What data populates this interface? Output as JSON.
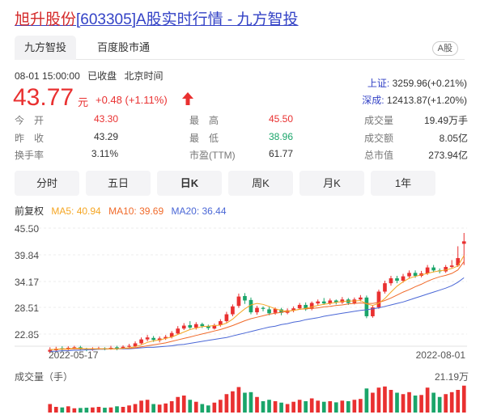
{
  "title": {
    "name": "旭升股份",
    "code": "[603305]",
    "suffix": "A股实时行情 - 九方智投"
  },
  "tabs": [
    {
      "label": "九方智投"
    },
    {
      "label": "百度股市通"
    }
  ],
  "badge": "A股",
  "status": {
    "time": "08-01 15:00:00",
    "state": "已收盘",
    "tz": "北京时间"
  },
  "quote": {
    "price": "43.77",
    "unit": "元",
    "change": "+0.48",
    "change_pct": "(+1.11%)"
  },
  "indices": [
    {
      "name": "上证:",
      "value": "3259.96(+0.21%)"
    },
    {
      "name": "深成:",
      "value": "12413.87(+1.20%)"
    }
  ],
  "stats": {
    "open_label": "今　开",
    "open": "43.30",
    "prev_label": "昨　收",
    "prev": "43.29",
    "turnover_label": "换手率",
    "turnover": "3.11%",
    "high_label": "最　高",
    "high": "45.50",
    "low_label": "最　低",
    "low": "38.96",
    "pe_label": "市盈(TTM)",
    "pe": "61.77",
    "vol_label": "成交量",
    "vol": "19.49万手",
    "amt_label": "成交额",
    "amt": "8.05亿",
    "cap_label": "总市值",
    "cap": "273.94亿"
  },
  "periods": [
    {
      "label": "分时"
    },
    {
      "label": "五日"
    },
    {
      "label": "日K"
    },
    {
      "label": "周K"
    },
    {
      "label": "月K"
    },
    {
      "label": "1年"
    }
  ],
  "active_period": "日K",
  "ma": {
    "adjust": "前复权",
    "ma5": "MA5: 40.94",
    "ma10": "MA10: 39.69",
    "ma20": "MA20: 36.44"
  },
  "colors": {
    "up": "#e93030",
    "down": "#1aa56a",
    "ma5": "#f5a623",
    "ma10": "#f06a2a",
    "ma20": "#4a67d6",
    "link": "#3342c6"
  },
  "chart_data": {
    "type": "candlestick",
    "y_ticks": [
      "45.50",
      "39.84",
      "34.17",
      "28.51",
      "22.85"
    ],
    "ylim": [
      22.85,
      45.5
    ],
    "x_start": "2022-05-17",
    "x_end": "2022-08-01",
    "volume_title": "成交量（手）",
    "volume_max": "21.19万",
    "candles": [
      [
        21.4,
        21.8,
        22.3,
        21.2
      ],
      [
        21.7,
        22.0,
        22.4,
        21.5
      ],
      [
        22.1,
        21.9,
        22.5,
        21.6
      ],
      [
        21.9,
        22.2,
        22.5,
        21.7
      ],
      [
        22.1,
        22.3,
        22.6,
        21.9
      ],
      [
        22.3,
        21.9,
        22.6,
        21.8
      ],
      [
        21.9,
        21.8,
        22.2,
        21.5
      ],
      [
        21.8,
        22.0,
        22.3,
        21.6
      ],
      [
        22.0,
        22.1,
        22.4,
        21.8
      ],
      [
        22.1,
        21.9,
        22.3,
        21.7
      ],
      [
        21.9,
        22.2,
        22.6,
        21.8
      ],
      [
        22.3,
        22.0,
        22.6,
        21.7
      ],
      [
        22.0,
        22.4,
        22.7,
        21.9
      ],
      [
        22.4,
        22.6,
        23.0,
        22.2
      ],
      [
        22.5,
        23.1,
        23.5,
        22.3
      ],
      [
        23.1,
        23.9,
        24.3,
        22.9
      ],
      [
        23.9,
        24.3,
        24.8,
        23.5
      ],
      [
        24.2,
        23.8,
        24.6,
        23.4
      ],
      [
        23.7,
        24.1,
        24.5,
        23.3
      ],
      [
        24.1,
        24.4,
        24.8,
        23.8
      ],
      [
        24.4,
        25.2,
        25.6,
        24.1
      ],
      [
        25.1,
        26.1,
        26.6,
        24.9
      ],
      [
        26.1,
        26.7,
        27.2,
        25.8
      ],
      [
        26.8,
        26.3,
        27.6,
        26.0
      ],
      [
        26.3,
        27.0,
        27.4,
        25.9
      ],
      [
        27.0,
        26.6,
        27.3,
        26.2
      ],
      [
        26.6,
        26.2,
        26.9,
        25.8
      ],
      [
        26.1,
        26.8,
        27.1,
        25.9
      ],
      [
        26.8,
        27.6,
        28.0,
        26.5
      ],
      [
        27.6,
        29.0,
        29.5,
        27.3
      ],
      [
        29.0,
        30.6,
        31.0,
        28.6
      ],
      [
        30.7,
        32.6,
        33.2,
        30.3
      ],
      [
        32.7,
        31.8,
        33.3,
        31.1
      ],
      [
        31.9,
        29.4,
        32.4,
        29.0
      ],
      [
        29.4,
        30.3,
        30.7,
        28.9
      ],
      [
        30.3,
        30.1,
        30.6,
        29.6
      ],
      [
        30.0,
        29.2,
        30.5,
        28.8
      ],
      [
        29.3,
        30.1,
        30.4,
        28.9
      ],
      [
        30.0,
        29.3,
        30.3,
        28.8
      ],
      [
        29.3,
        29.8,
        30.2,
        29.0
      ],
      [
        29.8,
        30.2,
        30.6,
        29.4
      ],
      [
        30.2,
        30.9,
        31.3,
        29.9
      ],
      [
        30.9,
        30.0,
        31.4,
        29.7
      ],
      [
        30.1,
        31.3,
        31.6,
        29.8
      ],
      [
        31.2,
        31.6,
        32.0,
        30.8
      ],
      [
        31.6,
        31.2,
        32.3,
        30.9
      ],
      [
        31.2,
        31.8,
        32.2,
        30.9
      ],
      [
        31.8,
        31.4,
        32.0,
        31.0
      ],
      [
        31.4,
        32.0,
        32.5,
        31.1
      ],
      [
        32.0,
        31.3,
        32.3,
        30.9
      ],
      [
        31.3,
        32.0,
        32.4,
        31.0
      ],
      [
        32.0,
        32.4,
        32.9,
        31.6
      ],
      [
        32.4,
        28.6,
        32.8,
        28.2
      ],
      [
        28.6,
        30.4,
        30.8,
        28.3
      ],
      [
        30.4,
        33.6,
        34.0,
        30.1
      ],
      [
        33.6,
        35.3,
        35.8,
        33.2
      ],
      [
        35.3,
        36.3,
        36.8,
        34.8
      ],
      [
        36.3,
        35.8,
        36.8,
        35.3
      ],
      [
        35.8,
        36.7,
        37.2,
        35.4
      ],
      [
        36.7,
        37.4,
        37.9,
        36.3
      ],
      [
        37.4,
        36.8,
        37.9,
        36.4
      ],
      [
        36.8,
        37.3,
        37.8,
        36.5
      ],
      [
        37.3,
        38.5,
        39.0,
        37.0
      ],
      [
        38.5,
        37.9,
        39.0,
        37.5
      ],
      [
        37.9,
        37.7,
        38.3,
        37.3
      ],
      [
        37.7,
        38.6,
        39.0,
        37.4
      ],
      [
        38.6,
        38.9,
        40.0,
        38.4
      ],
      [
        38.9,
        40.4,
        42.8,
        38.6
      ],
      [
        43.3,
        43.8,
        45.5,
        39.0
      ]
    ],
    "ma5": [
      21.8,
      21.9,
      22.0,
      22.0,
      22.1,
      22.1,
      22.0,
      22.0,
      22.0,
      22.0,
      22.0,
      22.0,
      22.1,
      22.2,
      22.4,
      22.8,
      23.3,
      23.6,
      23.8,
      24.1,
      24.4,
      24.9,
      25.4,
      25.9,
      26.2,
      26.5,
      26.6,
      26.7,
      26.8,
      27.2,
      28.0,
      29.1,
      30.1,
      30.9,
      31.2,
      31.0,
      30.6,
      30.1,
      29.8,
      29.6,
      29.8,
      30.0,
      30.2,
      30.5,
      30.8,
      31.0,
      31.2,
      31.4,
      31.6,
      31.7,
      31.7,
      31.8,
      31.1,
      30.8,
      31.2,
      32.2,
      33.5,
      34.7,
      35.6,
      36.3,
      36.7,
      37.0,
      37.3,
      37.6,
      37.8,
      38.0,
      38.3,
      38.8,
      40.9
    ],
    "ma10": [
      21.8,
      21.9,
      21.9,
      21.9,
      22.0,
      22.0,
      22.0,
      22.0,
      22.0,
      22.0,
      22.0,
      22.0,
      22.1,
      22.1,
      22.2,
      22.4,
      22.6,
      22.8,
      23.0,
      23.2,
      23.5,
      23.8,
      24.1,
      24.4,
      24.7,
      25.0,
      25.3,
      25.6,
      25.9,
      26.3,
      26.7,
      27.2,
      27.7,
      28.1,
      28.4,
      28.7,
      29.0,
      29.2,
      29.4,
      29.6,
      29.8,
      30.0,
      30.1,
      30.2,
      30.3,
      30.5,
      30.6,
      30.8,
      30.9,
      31.1,
      31.2,
      31.3,
      31.2,
      31.2,
      31.4,
      31.8,
      32.3,
      32.9,
      33.5,
      34.0,
      34.6,
      35.1,
      35.7,
      36.2,
      36.6,
      36.9,
      37.3,
      38.0,
      39.7
    ],
    "ma20": [
      21.5,
      21.5,
      21.6,
      21.6,
      21.7,
      21.7,
      21.8,
      21.8,
      21.9,
      21.9,
      22.0,
      22.0,
      22.0,
      22.0,
      22.1,
      22.2,
      22.3,
      22.3,
      22.4,
      22.5,
      22.6,
      22.8,
      22.9,
      23.1,
      23.3,
      23.5,
      23.7,
      23.9,
      24.1,
      24.3,
      24.6,
      24.9,
      25.2,
      25.5,
      25.8,
      26.1,
      26.4,
      26.6,
      26.9,
      27.1,
      27.4,
      27.6,
      27.9,
      28.1,
      28.3,
      28.6,
      28.8,
      29.0,
      29.2,
      29.4,
      29.6,
      29.8,
      29.9,
      30.1,
      30.3,
      30.6,
      30.9,
      31.2,
      31.5,
      31.9,
      32.3,
      32.7,
      33.1,
      33.5,
      33.9,
      34.3,
      34.8,
      35.5,
      36.4
    ],
    "volumes": [
      0.3,
      0.2,
      0.18,
      0.22,
      0.15,
      0.16,
      0.17,
      0.18,
      0.2,
      0.17,
      0.18,
      0.22,
      0.2,
      0.25,
      0.3,
      0.42,
      0.45,
      0.3,
      0.28,
      0.32,
      0.4,
      0.55,
      0.6,
      0.45,
      0.38,
      0.3,
      0.25,
      0.35,
      0.45,
      0.65,
      0.75,
      0.9,
      0.7,
      0.72,
      0.55,
      0.4,
      0.45,
      0.4,
      0.35,
      0.3,
      0.38,
      0.45,
      0.4,
      0.5,
      0.42,
      0.38,
      0.4,
      0.36,
      0.42,
      0.4,
      0.45,
      0.48,
      0.85,
      0.7,
      0.88,
      0.92,
      0.8,
      0.7,
      0.65,
      0.72,
      0.6,
      0.62,
      0.88,
      0.7,
      0.55,
      0.65,
      0.72,
      0.8,
      0.95
    ]
  }
}
